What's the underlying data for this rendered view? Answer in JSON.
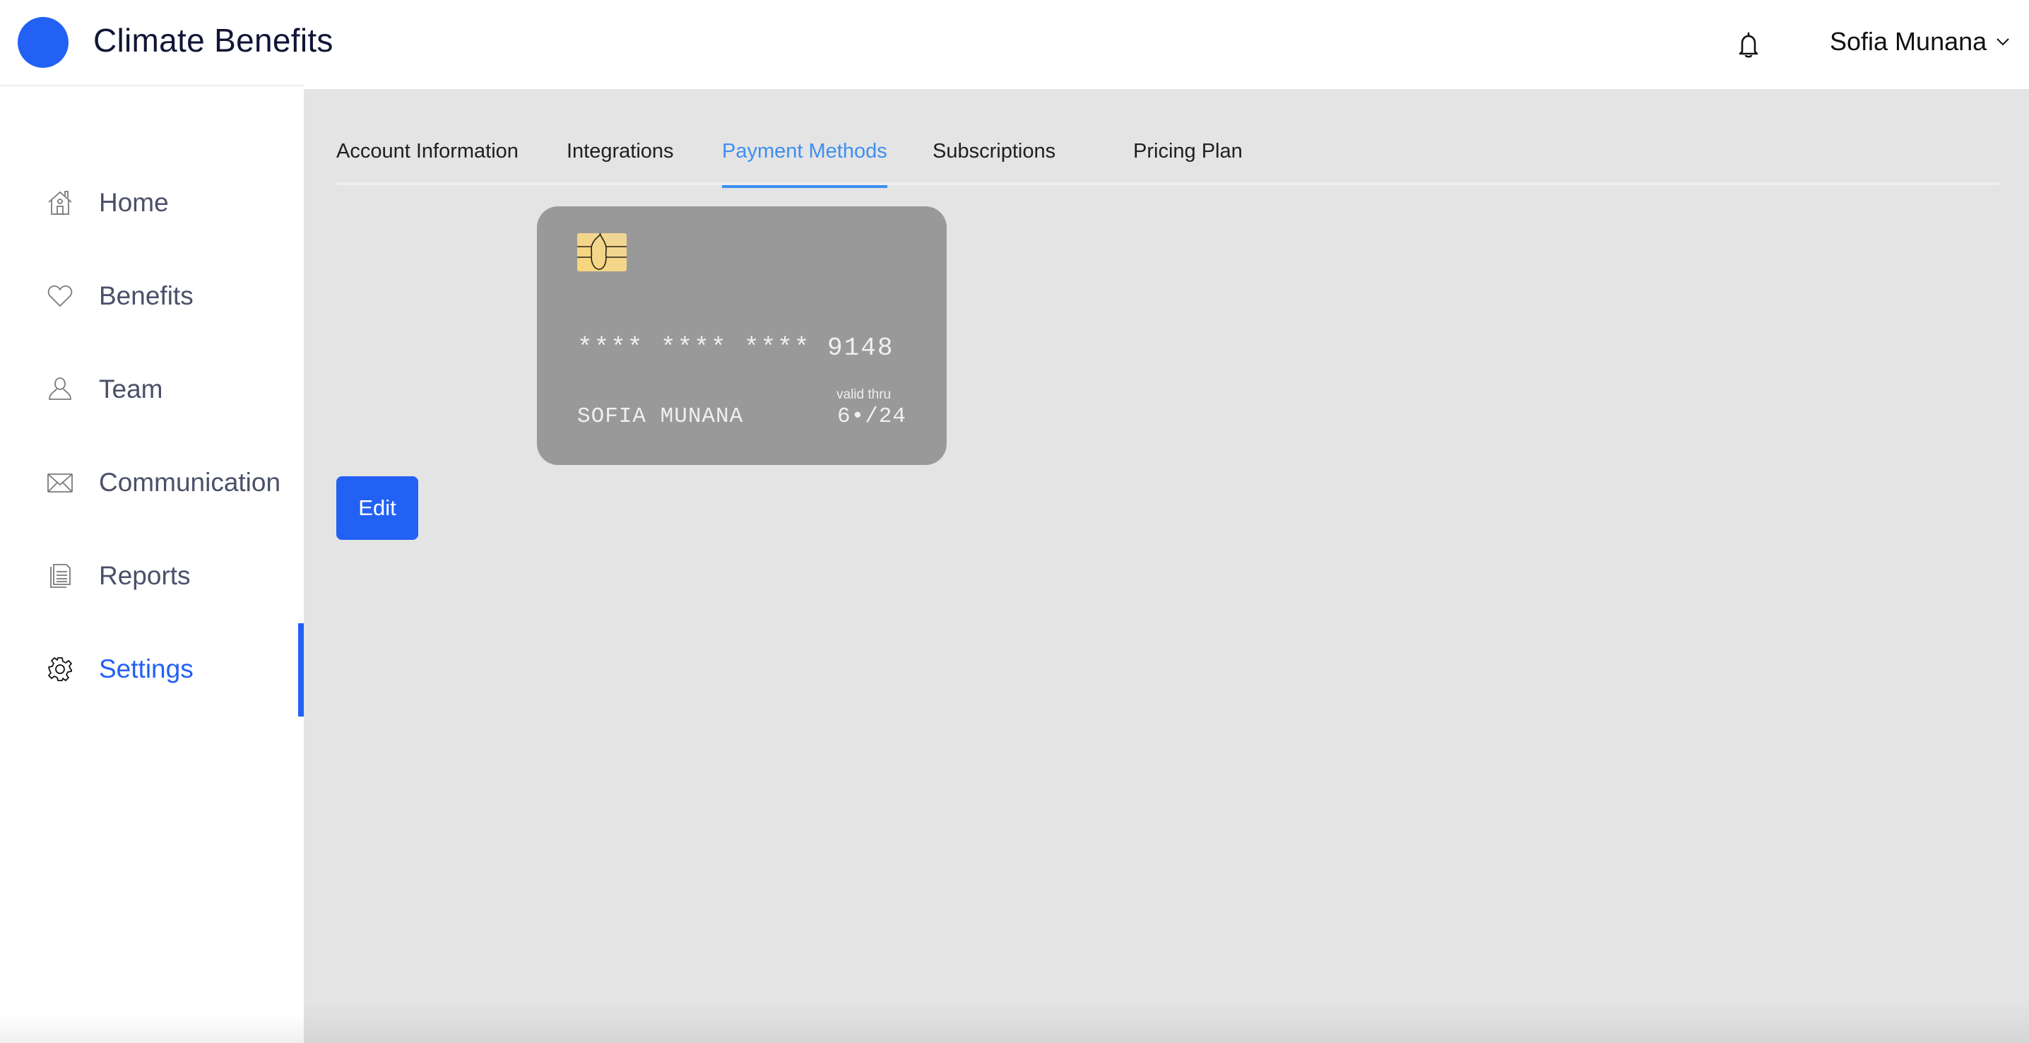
{
  "header": {
    "app_title": "Climate Benefits",
    "logo_color": "#2361f5",
    "notifications_icon": "bell-icon",
    "user_name": "Sofia Munana",
    "user_menu_icon": "chevron-down-icon"
  },
  "sidebar": {
    "items": [
      {
        "label": "Home",
        "icon": "home-icon",
        "active": false
      },
      {
        "label": "Benefits",
        "icon": "heart-icon",
        "active": false
      },
      {
        "label": "Team",
        "icon": "user-icon",
        "active": false
      },
      {
        "label": "Communication",
        "icon": "mail-icon",
        "active": false
      },
      {
        "label": "Reports",
        "icon": "document-icon",
        "active": false
      },
      {
        "label": "Settings",
        "icon": "gear-icon",
        "active": true
      }
    ],
    "accent_color": "#2361f5"
  },
  "settings": {
    "tabs": [
      {
        "label": "Account Information",
        "active": false
      },
      {
        "label": "Integrations",
        "active": false
      },
      {
        "label": "Payment Methods",
        "active": true
      },
      {
        "label": "Subscriptions",
        "active": false
      },
      {
        "label": "Pricing Plan",
        "active": false
      }
    ],
    "active_tab_color": "#3d8ff0"
  },
  "payment_card": {
    "number": "**** **** **** 9148",
    "holder": "SOFIA MUNANA",
    "valid_thru_label": "valid thru",
    "valid_thru": "6•/24",
    "card_color": "#999999",
    "chip_color": "#f2d88a"
  },
  "actions": {
    "edit_label": "Edit"
  }
}
